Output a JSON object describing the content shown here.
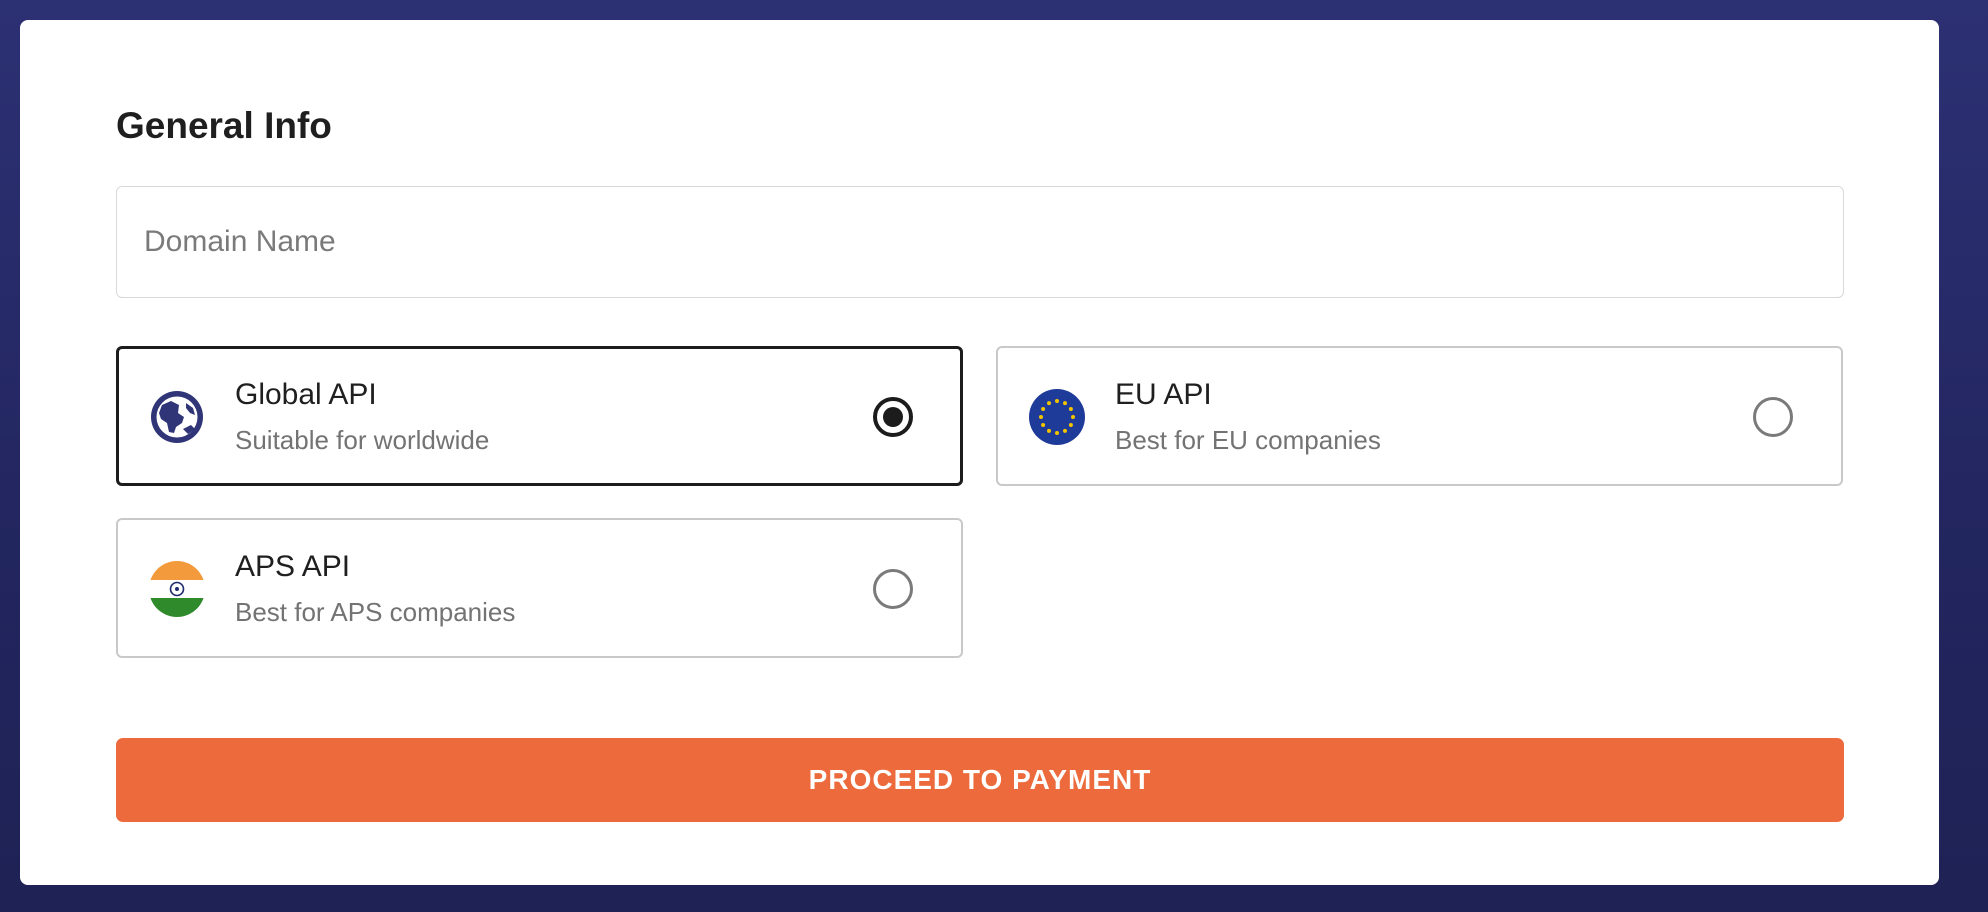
{
  "form": {
    "title": "General Info",
    "domain_input": {
      "placeholder": "Domain Name",
      "value": ""
    }
  },
  "api_options": [
    {
      "title": "Global API",
      "subtitle": "Suitable for worldwide",
      "icon": "globe-icon",
      "selected": true
    },
    {
      "title": "EU API",
      "subtitle": "Best for EU companies",
      "icon": "eu-flag-icon",
      "selected": false
    },
    {
      "title": "APS API",
      "subtitle": "Best for APS companies",
      "icon": "india-flag-icon",
      "selected": false
    }
  ],
  "actions": {
    "proceed_label": "PROCEED TO PAYMENT"
  },
  "colors": {
    "background": "#262a66",
    "card": "#ffffff",
    "accent_button": "#ec6a3b",
    "selected_border": "#1c1c1c",
    "unselected_border": "#c9c9c9",
    "globe": "#2f3576",
    "eu_blue": "#1f3b9a",
    "eu_stars": "#f3c500",
    "india_saffron": "#f39b3c",
    "india_green": "#2f8a2c",
    "india_chakra": "#1f2a6d"
  }
}
